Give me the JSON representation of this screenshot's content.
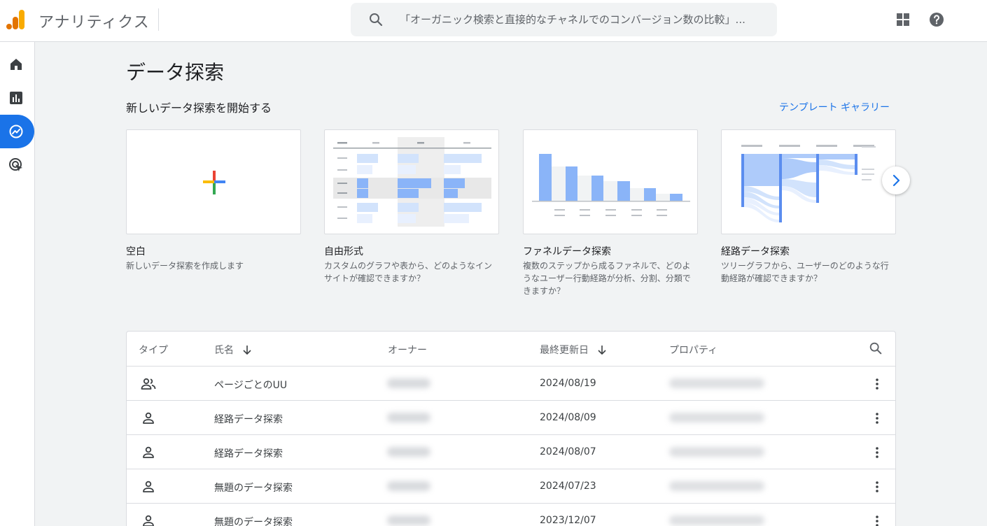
{
  "app": {
    "title": "アナリティクス"
  },
  "search": {
    "placeholder": "「オーガニック検索と直接的なチャネルでのコンバージョン数の比較」..."
  },
  "page": {
    "title": "データ探索",
    "section_title": "新しいデータ探索を開始する",
    "gallery_link": "テンプレート ギャラリー"
  },
  "templates": [
    {
      "name": "空白",
      "description": "新しいデータ探索を作成します"
    },
    {
      "name": "自由形式",
      "description": "カスタムのグラフや表から、どのようなインサイトが確認できますか？"
    },
    {
      "name": "ファネルデータ探索",
      "description": "複数のステップから成るファネルで、どのようなユーザー行動経路が分析、分割、分類できますか？"
    },
    {
      "name": "経路データ探索",
      "description": "ツリーグラフから、ユーザーのどのような行動経路が確認できますか？"
    }
  ],
  "table": {
    "columns": {
      "type": "タイプ",
      "name": "氏名",
      "owner": "オーナー",
      "updated": "最終更新日",
      "property": "プロパティ"
    },
    "rows": [
      {
        "type": "group-icon",
        "name": "ページごとのUU",
        "date": "2024/08/19"
      },
      {
        "type": "person-icon",
        "name": "経路データ探索",
        "date": "2024/08/09"
      },
      {
        "type": "person-icon",
        "name": "経路データ探索",
        "date": "2024/08/07"
      },
      {
        "type": "person-icon",
        "name": "無題のデータ探索",
        "date": "2024/07/23"
      },
      {
        "type": "person-icon",
        "name": "無題のデータ探索",
        "date": "2023/12/07"
      }
    ]
  },
  "colors": {
    "accent": "#1a73e8",
    "chart_blue": "#8ab4f8",
    "chart_light": "#d2e3fc",
    "logo_orange": "#f9ab00",
    "logo_dark": "#e37400"
  }
}
